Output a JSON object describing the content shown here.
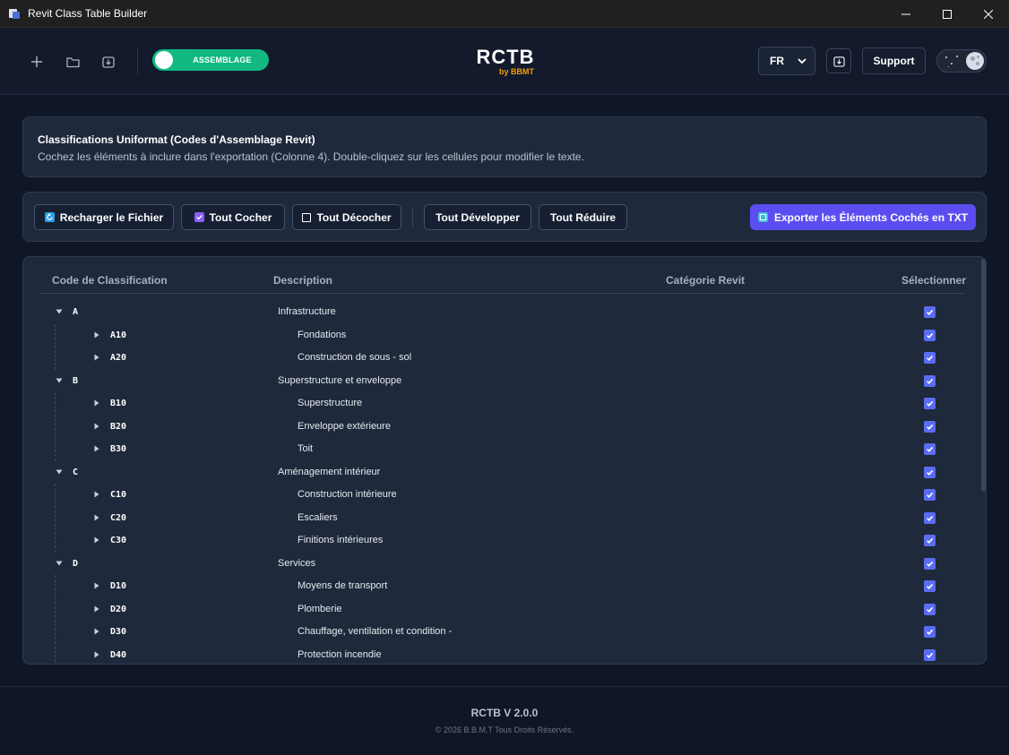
{
  "window": {
    "title": "Revit Class Table Builder"
  },
  "header": {
    "mode_toggle_label": "ASSEMBLAGE",
    "logo_main": "RCTB",
    "logo_sub": "by BBMT",
    "language": "FR",
    "support_label": "Support",
    "accent_color": "#11b981"
  },
  "info": {
    "title": "Classifications Uniformat (Codes d'Assemblage Revit)",
    "description": "Cochez les éléments à inclure dans l'exportation (Colonne 4). Double-cliquez sur les cellules pour modifier le texte."
  },
  "toolbar": {
    "reload_label": "Recharger le Fichier",
    "check_all_label": "Tout Cocher",
    "uncheck_all_label": "Tout Décocher",
    "expand_all_label": "Tout Développer",
    "collapse_all_label": "Tout Réduire",
    "export_label": "Exporter les Éléments Cochés en TXT",
    "export_color": "#5b4df0"
  },
  "table": {
    "columns": [
      "Code de Classification",
      "Description",
      "Catégorie Revit",
      "Sélectionner"
    ],
    "rows": [
      {
        "level": 0,
        "code": "A",
        "description": "Infrastructure",
        "category": "",
        "checked": true,
        "expanded": true
      },
      {
        "level": 1,
        "code": "A10",
        "description": "Fondations",
        "category": "",
        "checked": true,
        "expanded": false
      },
      {
        "level": 1,
        "code": "A20",
        "description": "Construction de sous - sol",
        "category": "",
        "checked": true,
        "expanded": false
      },
      {
        "level": 0,
        "code": "B",
        "description": "Superstructure et enveloppe",
        "category": "",
        "checked": true,
        "expanded": true
      },
      {
        "level": 1,
        "code": "B10",
        "description": "Superstructure",
        "category": "",
        "checked": true,
        "expanded": false
      },
      {
        "level": 1,
        "code": "B20",
        "description": "Enveloppe extérieure",
        "category": "",
        "checked": true,
        "expanded": false
      },
      {
        "level": 1,
        "code": "B30",
        "description": "Toit",
        "category": "",
        "checked": true,
        "expanded": false
      },
      {
        "level": 0,
        "code": "C",
        "description": "Aménagement intérieur",
        "category": "",
        "checked": true,
        "expanded": true
      },
      {
        "level": 1,
        "code": "C10",
        "description": "Construction intérieure",
        "category": "",
        "checked": true,
        "expanded": false
      },
      {
        "level": 1,
        "code": "C20",
        "description": "Escaliers",
        "category": "",
        "checked": true,
        "expanded": false
      },
      {
        "level": 1,
        "code": "C30",
        "description": "Finitions intérieures",
        "category": "",
        "checked": true,
        "expanded": false
      },
      {
        "level": 0,
        "code": "D",
        "description": "Services",
        "category": "",
        "checked": true,
        "expanded": true
      },
      {
        "level": 1,
        "code": "D10",
        "description": "Moyens de transport",
        "category": "",
        "checked": true,
        "expanded": false
      },
      {
        "level": 1,
        "code": "D20",
        "description": "Plomberie",
        "category": "",
        "checked": true,
        "expanded": false
      },
      {
        "level": 1,
        "code": "D30",
        "description": "Chauffage, ventilation et condition -",
        "category": "",
        "checked": true,
        "expanded": false
      },
      {
        "level": 1,
        "code": "D40",
        "description": "Protection incendie",
        "category": "",
        "checked": true,
        "expanded": false
      }
    ],
    "checkbox_color": "#5b6cf2"
  },
  "footer": {
    "version": "RCTB V 2.0.0",
    "copyright": "© 2026 B.B.M.T Tous Droits Réservés."
  },
  "icons": {
    "new": "plus-icon",
    "open": "folder-icon",
    "save": "download-icon",
    "import": "import-icon",
    "theme": "moon-icon"
  }
}
